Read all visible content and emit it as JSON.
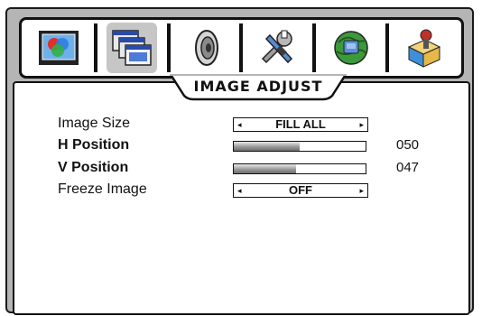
{
  "tabs": [
    {
      "icon": "color-picture-icon",
      "active": false
    },
    {
      "icon": "image-windows-icon",
      "active": true
    },
    {
      "icon": "speaker-icon",
      "active": false
    },
    {
      "icon": "tools-icon",
      "active": false
    },
    {
      "icon": "globe-icon",
      "active": false
    },
    {
      "icon": "network-user-icon",
      "active": false
    }
  ],
  "panel": {
    "title": "IMAGE ADJUST"
  },
  "settings": {
    "image_size": {
      "label": "Image Size",
      "value": "FILL ALL"
    },
    "h_position": {
      "label": "H Position",
      "value": "050",
      "level": 0.5
    },
    "v_position": {
      "label": "V Position",
      "value": "047",
      "level": 0.47
    },
    "freeze_image": {
      "label": "Freeze Image",
      "value": "OFF"
    }
  },
  "colors": {
    "frame": "#b5b5b5",
    "active_tab": "#c6c6c6",
    "outline": "#111111"
  }
}
